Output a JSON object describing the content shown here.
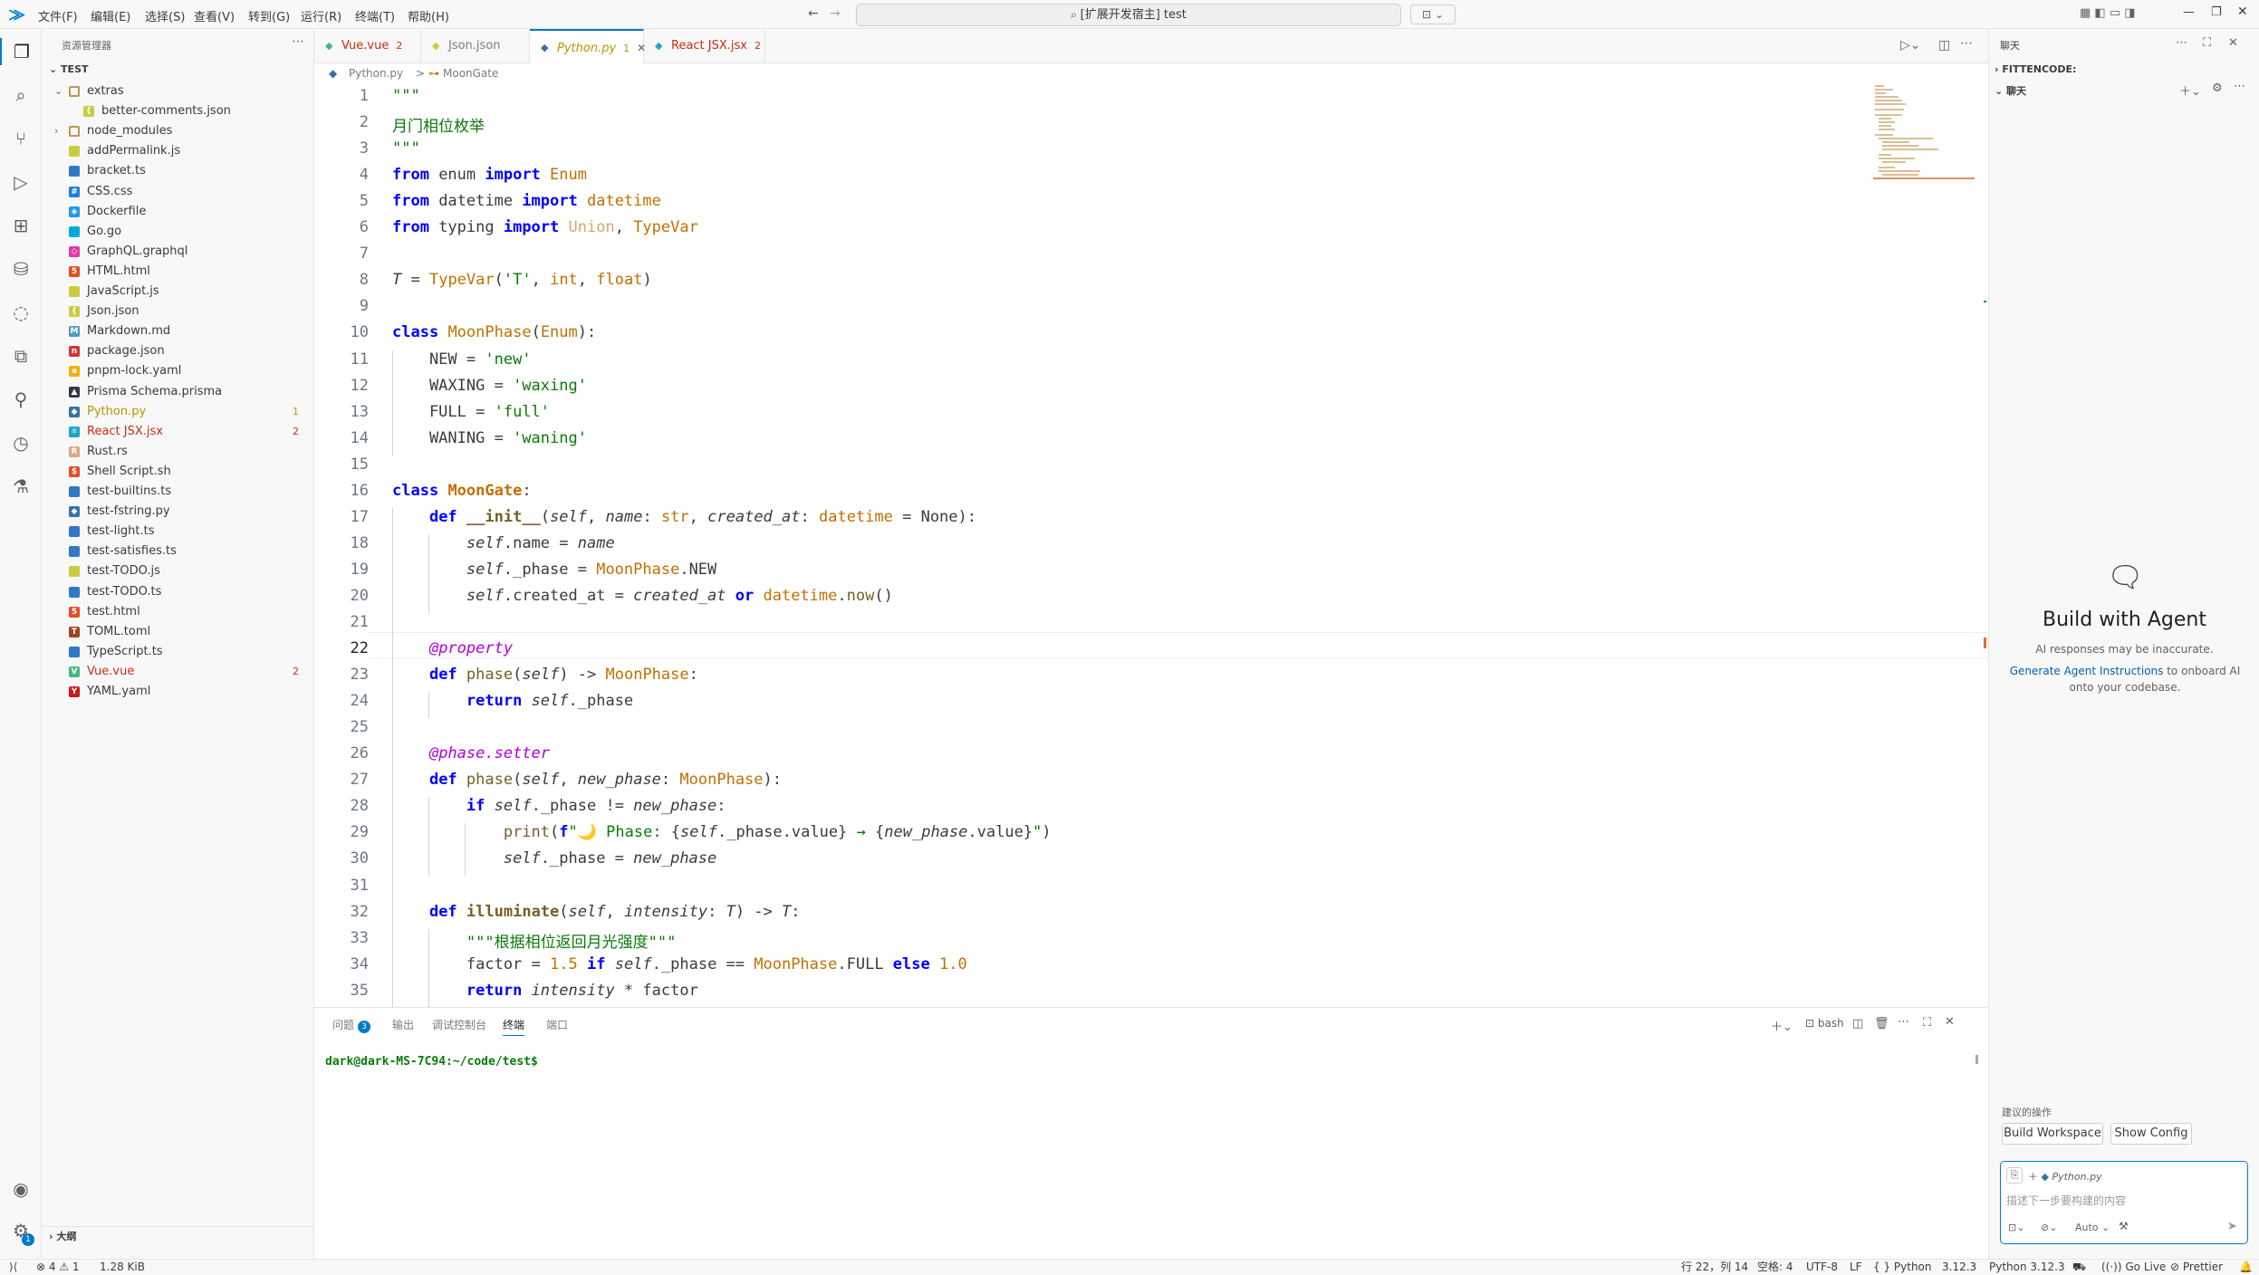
{
  "titlebar": {
    "menus": [
      "文件(F)",
      "编辑(E)",
      "选择(S)",
      "查看(V)",
      "转到(G)",
      "运行(R)",
      "终端(T)",
      "帮助(H)"
    ],
    "search": "[扩展开发宿主] test"
  },
  "sidebar": {
    "title": "资源管理器",
    "root": "TEST",
    "items": [
      {
        "label": "extras",
        "kind": "folder-open",
        "depth": 0
      },
      {
        "label": "better-comments.json",
        "kind": "json",
        "depth": 1
      },
      {
        "label": "node_modules",
        "kind": "folder",
        "depth": 0
      },
      {
        "label": "addPermalink.js",
        "kind": "js",
        "depth": 0
      },
      {
        "label": "bracket.ts",
        "kind": "ts",
        "depth": 0
      },
      {
        "label": "CSS.css",
        "kind": "css",
        "depth": 0
      },
      {
        "label": "Dockerfile",
        "kind": "docker",
        "depth": 0
      },
      {
        "label": "Go.go",
        "kind": "go",
        "depth": 0
      },
      {
        "label": "GraphQL.graphql",
        "kind": "graphql",
        "depth": 0
      },
      {
        "label": "HTML.html",
        "kind": "html",
        "depth": 0
      },
      {
        "label": "JavaScript.js",
        "kind": "js",
        "depth": 0
      },
      {
        "label": "Json.json",
        "kind": "json",
        "depth": 0
      },
      {
        "label": "Markdown.md",
        "kind": "md",
        "depth": 0
      },
      {
        "label": "package.json",
        "kind": "npm",
        "depth": 0
      },
      {
        "label": "pnpm-lock.yaml",
        "kind": "pnpm",
        "depth": 0
      },
      {
        "label": "Prisma Schema.prisma",
        "kind": "prisma",
        "depth": 0
      },
      {
        "label": "Python.py",
        "kind": "py",
        "depth": 0,
        "badge": "1",
        "color": "#b89500"
      },
      {
        "label": "React JSX.jsx",
        "kind": "jsx",
        "depth": 0,
        "badge": "2",
        "color": "#c72e0f"
      },
      {
        "label": "Rust.rs",
        "kind": "rs",
        "depth": 0
      },
      {
        "label": "Shell Script.sh",
        "kind": "sh",
        "depth": 0
      },
      {
        "label": "test-builtins.ts",
        "kind": "ts",
        "depth": 0
      },
      {
        "label": "test-fstring.py",
        "kind": "py",
        "depth": 0
      },
      {
        "label": "test-light.ts",
        "kind": "ts",
        "depth": 0
      },
      {
        "label": "test-satisfies.ts",
        "kind": "ts",
        "depth": 0
      },
      {
        "label": "test-TODO.js",
        "kind": "js",
        "depth": 0
      },
      {
        "label": "test-TODO.ts",
        "kind": "ts",
        "depth": 0
      },
      {
        "label": "test.html",
        "kind": "html",
        "depth": 0
      },
      {
        "label": "TOML.toml",
        "kind": "toml",
        "depth": 0
      },
      {
        "label": "TypeScript.ts",
        "kind": "ts",
        "depth": 0
      },
      {
        "label": "Vue.vue",
        "kind": "vue",
        "depth": 0,
        "badge": "2",
        "color": "#c72e0f"
      },
      {
        "label": "YAML.yaml",
        "kind": "yaml",
        "depth": 0
      }
    ],
    "outline": "大纲"
  },
  "tabs": [
    {
      "label": "Vue.vue",
      "badge": "2",
      "color": "#c72e0f"
    },
    {
      "label": "Json.json",
      "badge": "",
      "color": "#7b7b7b"
    },
    {
      "label": "Python.py",
      "badge": "1",
      "color": "#b89500",
      "active": true
    },
    {
      "label": "React JSX.jsx",
      "badge": "2",
      "color": "#c72e0f"
    }
  ],
  "breadcrumb": {
    "file": "Python.py",
    "sep": ">",
    "symbol": "MoonGate"
  },
  "code_lines": [
    "<span class=\"str\">\"\"\"</span>",
    "<span class=\"str\">月门相位枚举</span>",
    "<span class=\"str\">\"\"\"</span>",
    "<span class=\"kw\">from</span> enum <span class=\"kw\">import</span> <span class=\"cls\">Enum</span>",
    "<span class=\"kw\">from</span> datetime <span class=\"kw\">import</span> <span class=\"cls\">datetime</span>",
    "<span class=\"kw\">from</span> typing <span class=\"kw\">import</span> <span style=\"color:#d4a86a\">Union</span>, <span class=\"cls\">TypeVar</span>",
    "",
    "<span class=\"it\">T</span> = <span class=\"cls\">TypeVar</span>(<span class=\"str\">'T'</span>, <span class=\"cls\">int</span>, <span class=\"cls\">float</span>)",
    "",
    "<span class=\"kw\">class</span> <span class=\"cls\">MoonPhase</span>(<span class=\"cls\">Enum</span>):",
    "    NEW = <span class=\"str\">'new'</span>",
    "    WAXING = <span class=\"str\">'waxing'</span>",
    "    FULL = <span class=\"str\">'full'</span>",
    "    WANING = <span class=\"str\">'waning'</span>",
    "",
    "<span class=\"kw\">class</span> <span class=\"cls\" style=\"font-weight:bold\">MoonGate</span>:",
    "    <span class=\"kw\">def</span> <span class=\"fn\" style=\"font-weight:bold\">__init__</span>(<span class=\"it\">self</span>, <span class=\"it\">name</span>: <span class=\"cls\">str</span>, <span class=\"it\">created_at</span>: <span class=\"cls\">datetime</span> = None):",
    "        <span class=\"it\">self</span>.name = <span class=\"it\">name</span>",
    "        <span class=\"it\">self</span>._phase = <span class=\"cls\">MoonPhase</span>.NEW",
    "        <span class=\"it\">self</span>.created_at = <span class=\"it\">created_at</span> <span class=\"kw\">or</span> <span class=\"cls\">datetime</span>.<span class=\"fn\">now</span>()",
    "",
    "    <span class=\"dec\">@property</span>",
    "    <span class=\"kw\">def</span> <span class=\"fn\">phase</span>(<span class=\"it\">self</span>) -&gt; <span class=\"cls\">MoonPhase</span>:",
    "        <span class=\"kw\">return</span> <span class=\"it\">self</span>._phase",
    "",
    "    <span class=\"dec\">@phase.setter</span>",
    "    <span class=\"kw\">def</span> <span class=\"fn\">phase</span>(<span class=\"it\">self</span>, <span class=\"it\">new_phase</span>: <span class=\"cls\">MoonPhase</span>):",
    "        <span class=\"kw\">if</span> <span class=\"it\">self</span>._phase != <span class=\"it\">new_phase</span>:",
    "            <span class=\"fn\">print</span>(<span class=\"kw\">f</span><span class=\"str\">\"🌙 Phase: </span>{<span class=\"it\">self</span>._phase.value}<span class=\"str\"> → </span>{<span class=\"it\">new_phase</span>.value}<span class=\"str\">\"</span>)",
    "            <span class=\"it\">self</span>._phase = <span class=\"it\">new_phase</span>",
    "",
    "    <span class=\"kw\">def</span> <span class=\"fn\" style=\"font-weight:bold\">illuminate</span>(<span class=\"it\">self</span>, <span class=\"it\">intensity</span>: <span class=\"it\">T</span>) -&gt; <span class=\"it\">T</span>:",
    "        <span class=\"str\">\"\"\"根据相位返回月光强度\"\"\"</span>",
    "        factor = <span class=\"num\">1.5</span> <span class=\"kw\">if</span> <span class=\"it\">self</span>._phase == <span class=\"cls\">MoonPhase</span>.FULL <span class=\"kw\">else</span> <span class=\"num\">1.0</span>",
    "        <span class=\"kw\">return</span> <span class=\"it\">intensity</span> * factor"
  ],
  "panel": {
    "tabs": [
      "问题",
      "输出",
      "调试控制台",
      "终端",
      "端口"
    ],
    "problems_count": "3",
    "shell": "bash",
    "prompt": "dark@dark-MS-7C94:~/code/test$"
  },
  "chat": {
    "title": "聊天",
    "section1": "FITTENCODE:",
    "section2": "聊天",
    "heading": "Build with Agent",
    "disclaimer": "AI responses may be inaccurate.",
    "link": "Generate Agent Instructions",
    "link_rest": " to onboard AI onto your codebase.",
    "suggest_label": "建议的操作",
    "btn1": "Build Workspace",
    "btn2": "Show Config",
    "input_file": "Python.py",
    "input_placeholder": "描述下一步要构建的内容",
    "mode": "Auto"
  },
  "statusbar": {
    "errors": "4",
    "warnings": "1",
    "size": "1.28 KiB",
    "position": "行 22，列 14",
    "spaces": "空格: 4",
    "encoding": "UTF-8",
    "eol": "LF",
    "lang": "Python",
    "version": "3.12.3",
    "interpreter": "Python 3.12.3",
    "golive": "Go Live",
    "prettier": "Prettier"
  },
  "colors": {
    "accent": "#007acc",
    "error": "#c72e0f",
    "warning": "#b89500"
  }
}
